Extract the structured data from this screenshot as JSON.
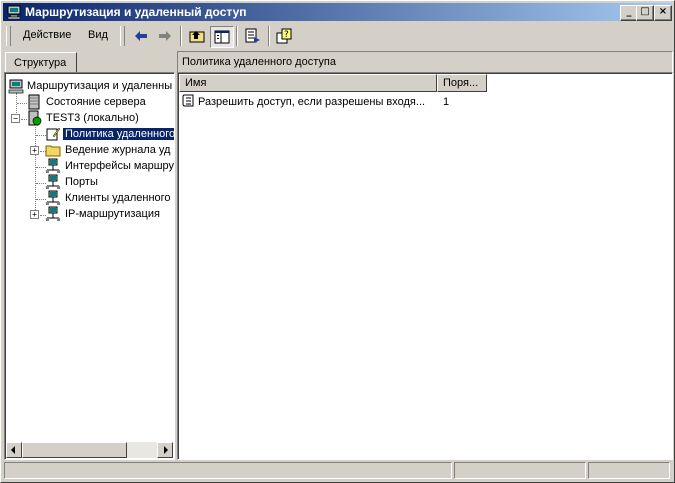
{
  "window": {
    "title": "Маршрутизация и удаленный доступ"
  },
  "caption_buttons": {
    "minimize": "_",
    "maximize": "□",
    "close": "×"
  },
  "menu": {
    "action": "Действие",
    "view": "Вид"
  },
  "toolbar": {
    "icons": [
      "back-arrow",
      "forward-arrow",
      "up-folder",
      "show-hide-tree",
      "export-list",
      "help"
    ]
  },
  "left_pane": {
    "tab_label": "Структура",
    "tree": [
      {
        "label": "Маршрутизация и удаленны",
        "icon": "routing-computer"
      },
      {
        "label": "Состояние сервера",
        "icon": "server-status"
      },
      {
        "label": "TEST3 (локально)",
        "icon": "server-local",
        "expander": "−"
      },
      {
        "label": "Политика удаленного",
        "icon": "remote-access-policy",
        "selected": true
      },
      {
        "label": "Ведение журнала уд",
        "icon": "folder",
        "expander": "+"
      },
      {
        "label": "Интерфейсы маршру",
        "icon": "network"
      },
      {
        "label": "Порты",
        "icon": "network"
      },
      {
        "label": "Клиенты удаленного",
        "icon": "network"
      },
      {
        "label": "IP-маршрутизация",
        "icon": "network",
        "expander": "+"
      }
    ]
  },
  "right_pane": {
    "title": "Политика удаленного доступа",
    "columns": [
      {
        "label": "Имя"
      },
      {
        "label": "Поря..."
      }
    ],
    "rows": [
      {
        "name": "Разрешить доступ, если разрешены входя...",
        "order": "1"
      }
    ]
  },
  "colors": {
    "title_start": "#0a246a",
    "title_end": "#a6caf0",
    "face": "#d4d0c8",
    "selection": "#0a246a"
  }
}
